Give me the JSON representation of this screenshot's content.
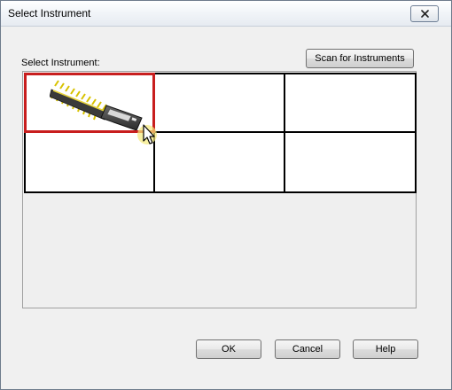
{
  "window": {
    "title": "Select Instrument"
  },
  "panel": {
    "label": "Select Instrument:",
    "scan_button": "Scan for Instruments",
    "cells": [
      {
        "has_instrument": true,
        "selected": true,
        "icon": "instrument-probe-icon"
      },
      {
        "has_instrument": false,
        "selected": false
      },
      {
        "has_instrument": false,
        "selected": false
      },
      {
        "has_instrument": false,
        "selected": false
      },
      {
        "has_instrument": false,
        "selected": false
      },
      {
        "has_instrument": false,
        "selected": false
      }
    ]
  },
  "buttons": {
    "ok": "OK",
    "cancel": "Cancel",
    "help": "Help"
  },
  "colors": {
    "selection_border": "#c81e1e",
    "dialog_background": "#f0f0f0"
  }
}
